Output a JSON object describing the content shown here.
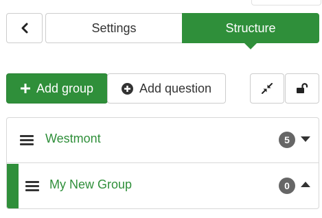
{
  "tabs": [
    {
      "label": "Settings",
      "active": false
    },
    {
      "label": "Structure",
      "active": true
    }
  ],
  "toolbar": {
    "add_group_label": "Add group",
    "add_question_label": "Add question"
  },
  "groups": [
    {
      "name": "Westmont",
      "count": "5",
      "expanded": false
    },
    {
      "name": "My New Group",
      "count": "0",
      "expanded": true
    }
  ],
  "colors": {
    "accent": "#2f8f3a",
    "badge": "#666666",
    "text": "#333333",
    "border": "#cccccc"
  },
  "icons": {
    "back": "chevron-left-icon",
    "add_group": "plus-icon",
    "add_question": "plus-circle-icon",
    "collapse": "compress-icon",
    "lock": "unlock-icon",
    "drag": "hamburger-icon",
    "collapsed_toggle": "caret-down-icon",
    "expanded_toggle": "caret-up-icon"
  }
}
